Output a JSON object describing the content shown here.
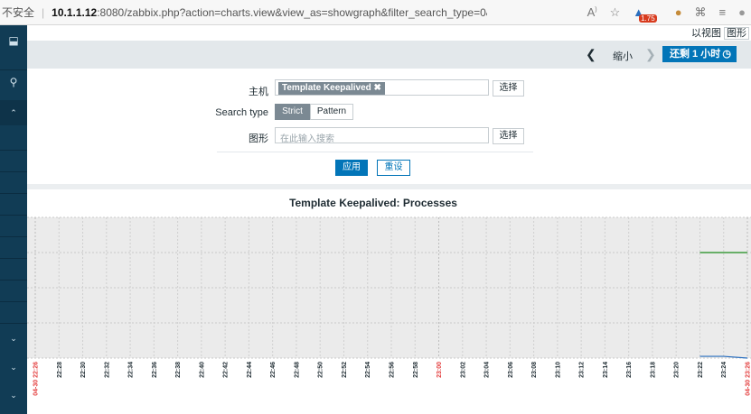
{
  "browser": {
    "insecure_label": "不安全",
    "url_host": "10.1.1.12",
    "url_path": ":8080/zabbix.php?action=charts.view&view_as=showgraph&filter_search_type=0&filter_h...",
    "badge_count": "1.75"
  },
  "header": {
    "view_list": "以视图",
    "view_graph": "图形"
  },
  "timebar": {
    "prev_icon": "chevron-left-icon",
    "zoom_out": "缩小",
    "next_icon": "chevron-right-icon",
    "period_button": "还剩 1 小时"
  },
  "filter": {
    "host_label": "主机",
    "host_chip": "Template Keepalived",
    "host_chip_remove": "✖",
    "select_label": "选择",
    "search_type_label": "Search type",
    "search_type_options": [
      "Strict",
      "Pattern"
    ],
    "search_type_selected": "Strict",
    "graph_label": "图形",
    "graph_placeholder": "在此输入搜索",
    "select_label_2": "选择",
    "apply": "应用",
    "reset": "重设"
  },
  "colors": {
    "accent": "#0275b8",
    "sidebar": "#113c55",
    "series_green": "#1a8b1a",
    "series_blue": "#2a6fbf",
    "tick_red": "#e33b3b"
  },
  "chart_data": {
    "type": "line",
    "title": "Template Keepalived: Processes",
    "x_tick_labels": [
      "04-30 22:26",
      "22:28",
      "22:30",
      "22:32",
      "22:34",
      "22:36",
      "22:38",
      "22:40",
      "22:42",
      "22:44",
      "22:46",
      "22:48",
      "22:50",
      "22:52",
      "22:54",
      "22:56",
      "22:58",
      "23:00",
      "23:02",
      "23:04",
      "23:06",
      "23:08",
      "23:10",
      "23:12",
      "23:14",
      "23:16",
      "23:18",
      "23:20",
      "23:22",
      "23:24",
      "04-30 23:26"
    ],
    "highlighted_ticks": [
      "04-30 22:26",
      "23:00",
      "04-30 23:26"
    ],
    "series": [
      {
        "color": "#1a8b1a",
        "x": [
          "23:22",
          "23:26"
        ],
        "values": [
          3,
          3
        ]
      },
      {
        "color": "#2a6fbf",
        "x": [
          "23:22",
          "23:24",
          "23:26"
        ],
        "values": [
          0.05,
          0.05,
          0
        ]
      }
    ],
    "ylim": [
      0,
      4
    ],
    "grid": true
  }
}
